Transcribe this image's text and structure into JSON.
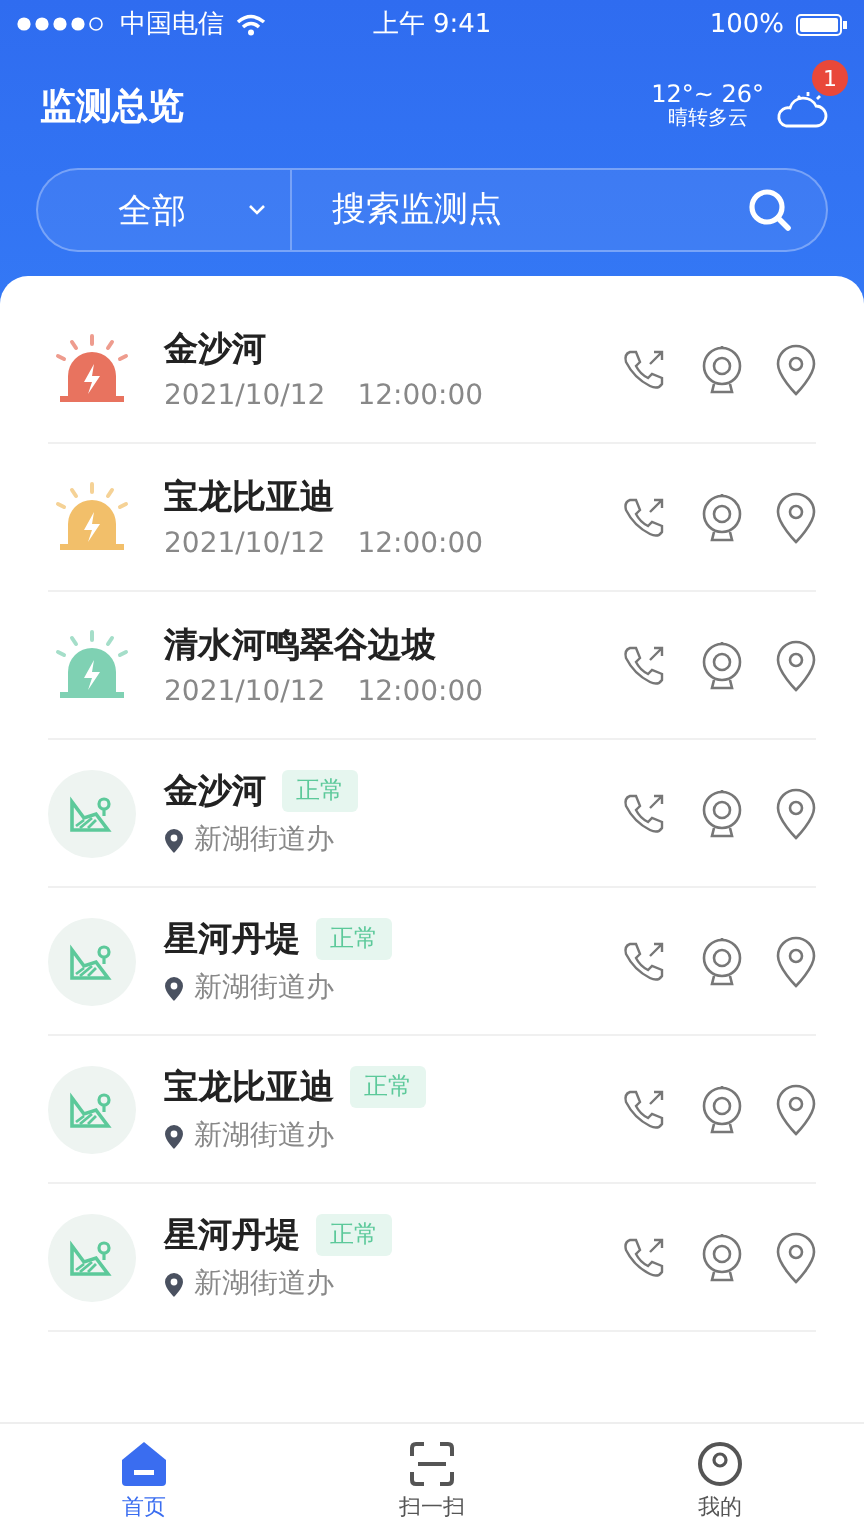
{
  "status_bar": {
    "carrier": "中国电信",
    "time": "上午 9:41",
    "battery": "100%"
  },
  "header": {
    "title": "监测总览",
    "weather": {
      "temp": "12°~ 26°",
      "desc": "晴转多云",
      "badge": "1"
    }
  },
  "search": {
    "filter": "全部",
    "placeholder": "搜索监测点"
  },
  "items": [
    {
      "kind": "alarm",
      "name": "金沙河",
      "date": "2021/10/12",
      "time": "12:00:00",
      "color": "#e8735f"
    },
    {
      "kind": "alarm",
      "name": "宝龙比亚迪",
      "date": "2021/10/12",
      "time": "12:00:00",
      "color": "#f2bf6a"
    },
    {
      "kind": "alarm",
      "name": "清水河鸣翠谷边坡",
      "date": "2021/10/12",
      "time": "12:00:00",
      "color": "#7fd1b3"
    },
    {
      "kind": "station",
      "name": "金沙河",
      "status": "正常",
      "location": "新湖街道办"
    },
    {
      "kind": "station",
      "name": "星河丹堤",
      "status": "正常",
      "location": "新湖街道办"
    },
    {
      "kind": "station",
      "name": "宝龙比亚迪",
      "status": "正常",
      "location": "新湖街道办"
    },
    {
      "kind": "station",
      "name": "星河丹堤",
      "status": "正常",
      "location": "新湖街道办"
    }
  ],
  "tabs": [
    {
      "label": "首页",
      "selected": true
    },
    {
      "label": "扫一扫",
      "selected": false
    },
    {
      "label": "我的",
      "selected": false
    }
  ]
}
